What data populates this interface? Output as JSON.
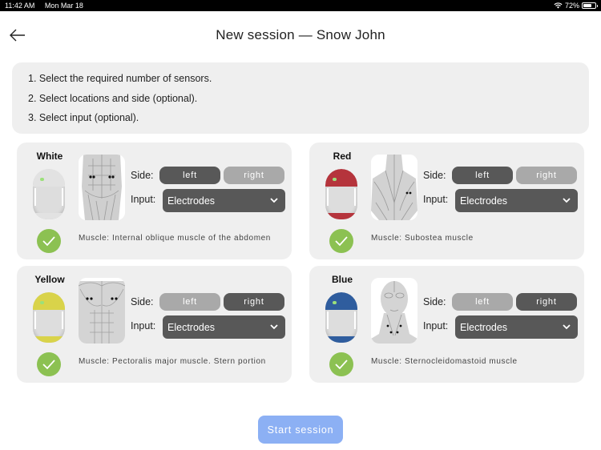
{
  "status_bar": {
    "time": "11:42 AM",
    "date": "Mon Mar 18",
    "battery": "72%",
    "battery_fraction": 0.72
  },
  "header": {
    "title": "New session — Snow John",
    "back_icon": "arrow-left-icon"
  },
  "instructions": [
    "1. Select the required number of sensors.",
    "2. Select locations and side (optional).",
    "3. Select input (optional)."
  ],
  "labels": {
    "side": "Side:",
    "input": "Input:",
    "left": "left",
    "right": "right"
  },
  "sensors": [
    {
      "name": "White",
      "color": "#d9d9d9",
      "side_selected": "left",
      "input": "Electrodes",
      "muscle": "Muscle: Internal oblique muscle of the abdomen",
      "selected": true,
      "image": "abdomen-muscle-illustration"
    },
    {
      "name": "Red",
      "color": "#b5343c",
      "side_selected": "left",
      "input": "Electrodes",
      "muscle": "Muscle: Subostea muscle",
      "selected": true,
      "image": "back-muscle-illustration"
    },
    {
      "name": "Yellow",
      "color": "#d9d34a",
      "side_selected": "right",
      "input": "Electrodes",
      "muscle": "Muscle: Pectoralis major muscle. Stern portion",
      "selected": true,
      "image": "chest-muscle-illustration"
    },
    {
      "name": "Blue",
      "color": "#2f5d9e",
      "side_selected": "right",
      "input": "Electrodes",
      "muscle": "Muscle: Sternocleidomastoid muscle",
      "selected": true,
      "image": "neck-muscle-illustration"
    }
  ],
  "footer": {
    "start_label": "Start session",
    "start_color": "#8cb0f4"
  }
}
